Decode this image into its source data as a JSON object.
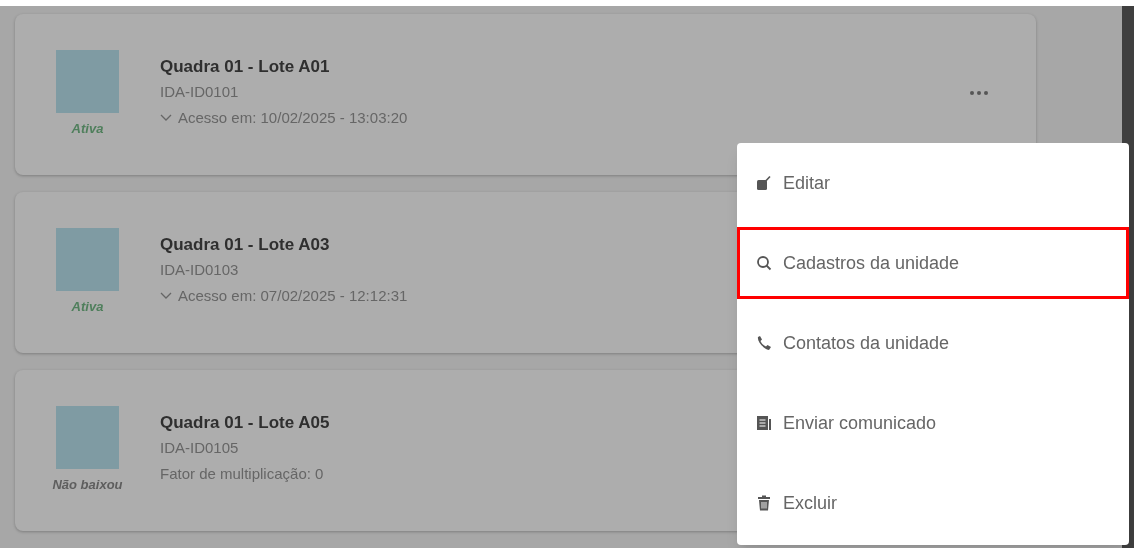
{
  "units": [
    {
      "title": "Quadra 01 - Lote A01",
      "code": "IDA-ID0101",
      "status": "Ativa",
      "color": "#4f7f5c",
      "kind": "access",
      "detail": "Acesso em: 10/02/2025 - 13:03:20",
      "has_menu_button": true
    },
    {
      "title": "Quadra 01 - Lote A03",
      "code": "IDA-ID0103",
      "status": "Ativa",
      "color": "#4f7f5c",
      "kind": "access",
      "detail": "Acesso em: 07/02/2025 - 12:12:31"
    },
    {
      "title": "Quadra 01 - Lote A05",
      "code": "IDA-ID0105",
      "status": "Não baixou",
      "color": "#5e5e5e",
      "kind": "plain",
      "detail": "Fator de multiplicação: 0"
    }
  ],
  "menu": {
    "items": [
      {
        "kind": "edit",
        "label": "Editar",
        "selected": false
      },
      {
        "kind": "search",
        "label": "Cadastros da unidade",
        "selected": true
      },
      {
        "kind": "phone",
        "label": "Contatos da unidade",
        "selected": false
      },
      {
        "kind": "document",
        "label": "Enviar comunicado",
        "selected": false
      },
      {
        "kind": "trash",
        "label": "Excluir",
        "selected": false
      }
    ]
  }
}
